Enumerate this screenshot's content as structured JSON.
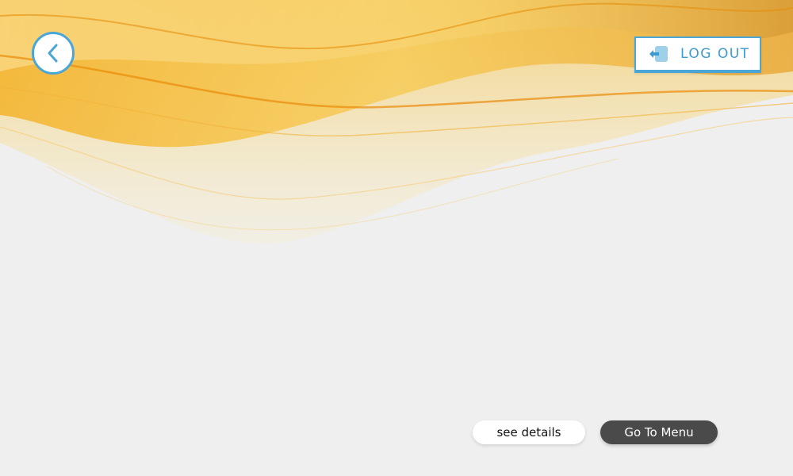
{
  "header": {
    "back_icon": "chevron-left-icon",
    "logout_icon": "logout-door-icon",
    "logout_label": "LOG OUT"
  },
  "actions": {
    "see_details_label": "see details",
    "go_to_menu_label": "Go To Menu"
  },
  "colors": {
    "background": "#efefef",
    "accent_blue": "#4aa6d6",
    "wave_orange": "#f2a516",
    "wave_gold": "#f6c94a",
    "menu_button": "#4a4a4a"
  }
}
